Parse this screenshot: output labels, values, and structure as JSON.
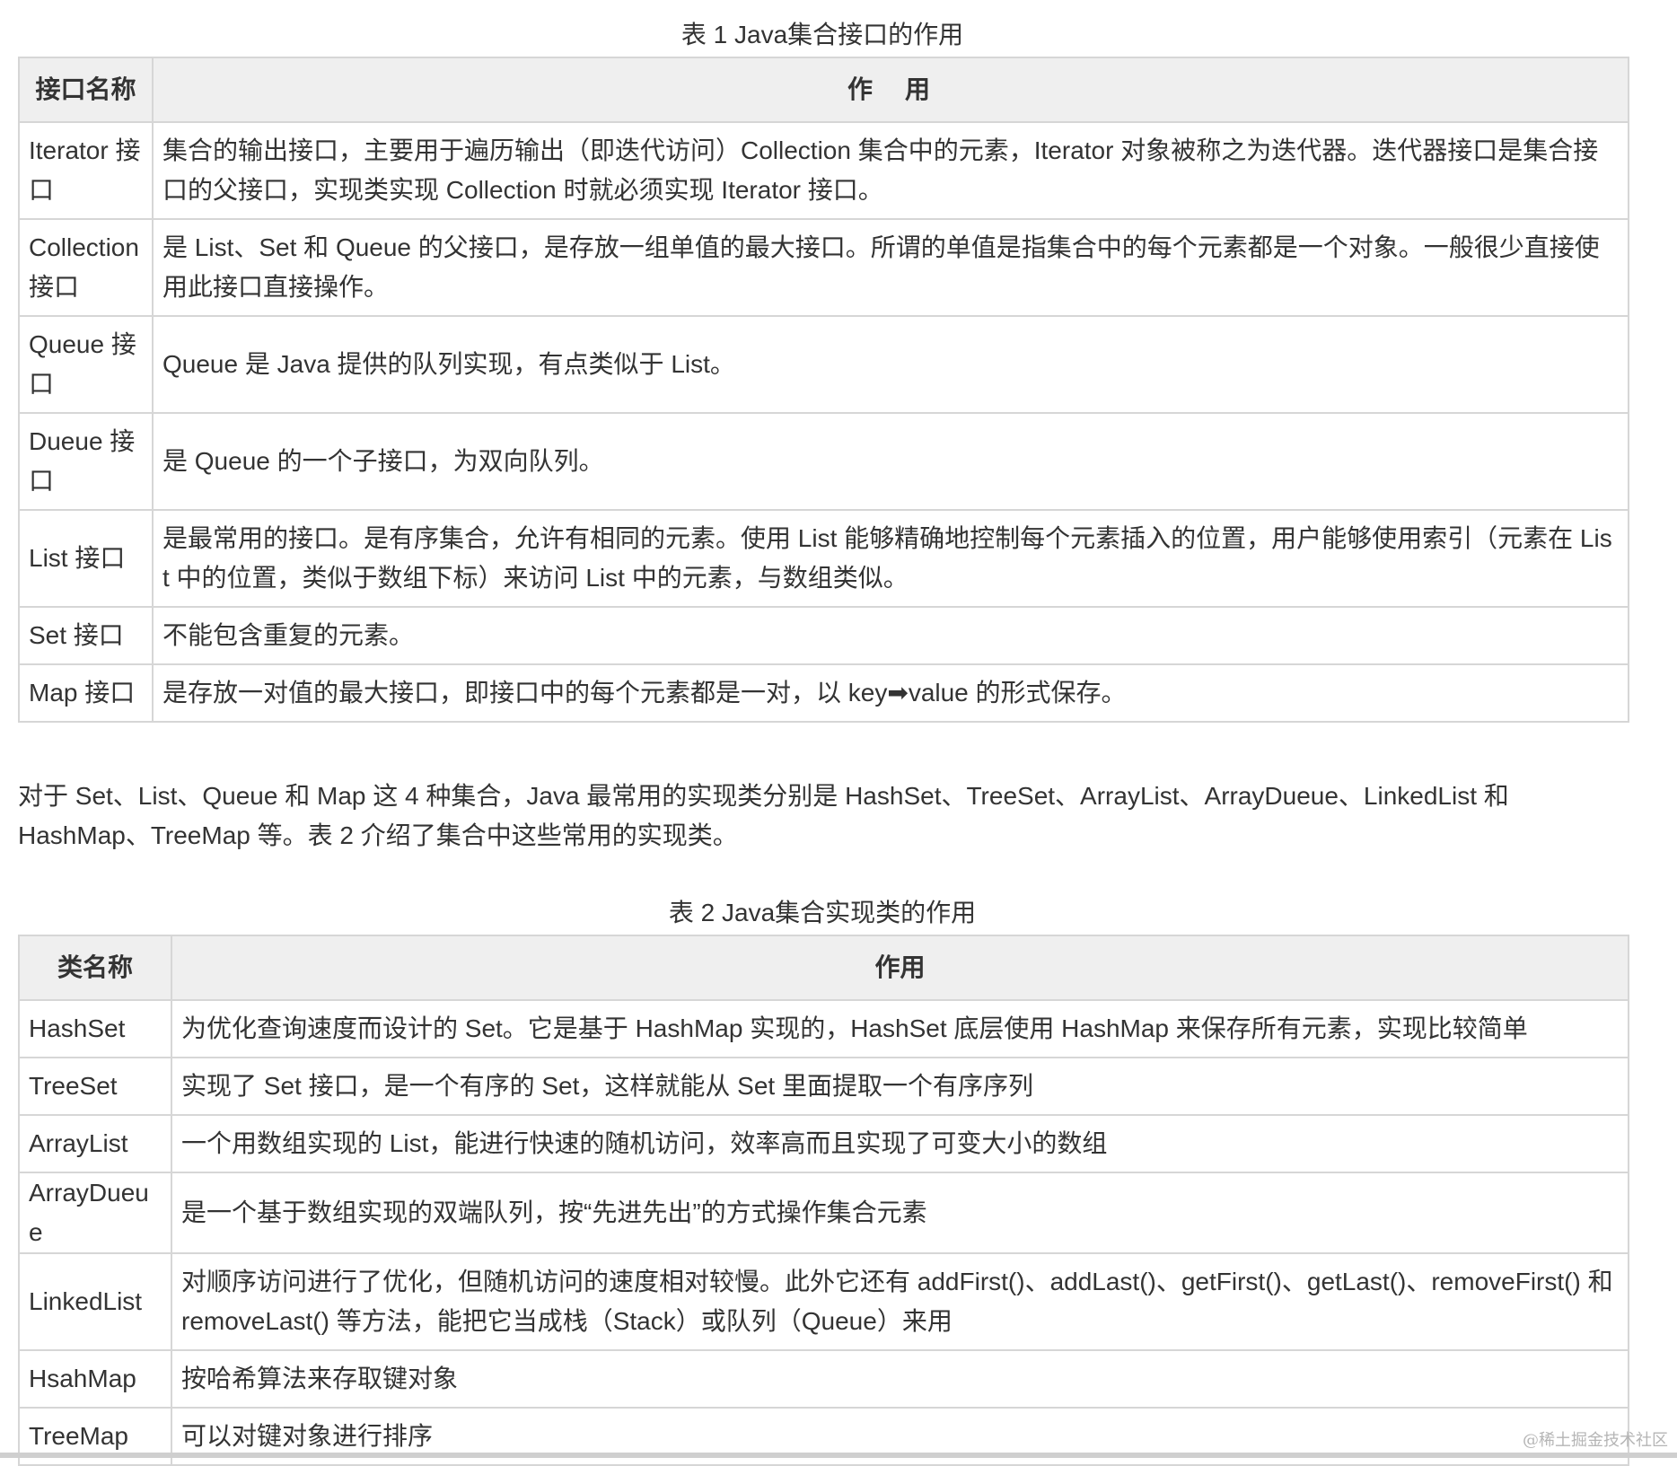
{
  "table1": {
    "caption": "表 1 Java集合接口的作用",
    "headers": [
      "接口名称",
      "作　用"
    ],
    "rows": [
      {
        "name": "Iterator 接口",
        "desc": "集合的输出接口，主要用于遍历输出（即迭代访问）Collection 集合中的元素，Iterator 对象被称之为迭代器。迭代器接口是集合接口的父接口，实现类实现 Collection 时就必须实现 Iterator 接口。"
      },
      {
        "name": "Collection 接口",
        "desc": "是 List、Set 和 Queue 的父接口，是存放一组单值的最大接口。所谓的单值是指集合中的每个元素都是一个对象。一般很少直接使用此接口直接操作。"
      },
      {
        "name": "Queue 接口",
        "desc": "Queue 是 Java 提供的队列实现，有点类似于 List。"
      },
      {
        "name": "Dueue 接口",
        "desc": "是 Queue 的一个子接口，为双向队列。"
      },
      {
        "name": "List 接口",
        "desc": "是最常用的接口。是有序集合，允许有相同的元素。使用 List 能够精确地控制每个元素插入的位置，用户能够使用索引（元素在 List 中的位置，类似于数组下标）来访问 List 中的元素，与数组类似。"
      },
      {
        "name": "Set 接口",
        "desc": "不能包含重复的元素。"
      },
      {
        "name": "Map 接口",
        "desc": "是存放一对值的最大接口，即接口中的每个元素都是一对，以 key➡value 的形式保存。"
      }
    ]
  },
  "paragraph": "对于 Set、List、Queue 和 Map 这 4 种集合，Java 最常用的实现类分别是 HashSet、TreeSet、ArrayList、ArrayDueue、LinkedList 和 HashMap、TreeMap 等。表 2 介绍了集合中这些常用的实现类。",
  "table2": {
    "caption": "表 2 Java集合实现类的作用",
    "headers": [
      "类名称",
      "作用"
    ],
    "rows": [
      {
        "name": "HashSet",
        "desc": "为优化查询速度而设计的 Set。它是基于 HashMap 实现的，HashSet 底层使用 HashMap 来保存所有元素，实现比较简单"
      },
      {
        "name": "TreeSet",
        "desc": "实现了 Set 接口，是一个有序的 Set，这样就能从 Set 里面提取一个有序序列"
      },
      {
        "name": "ArrayList",
        "desc": "一个用数组实现的 List，能进行快速的随机访问，效率高而且实现了可变大小的数组"
      },
      {
        "name": "ArrayDueue",
        "desc": "是一个基于数组实现的双端队列，按“先进先出”的方式操作集合元素"
      },
      {
        "name": "LinkedList",
        "desc": "对顺序访问进行了优化，但随机访问的速度相对较慢。此外它还有 addFirst()、addLast()、getFirst()、getLast()、removeFirst() 和 removeLast() 等方法，能把它当成栈（Stack）或队列（Queue）来用"
      },
      {
        "name": "HsahMap",
        "desc": "按哈希算法来存取键对象"
      },
      {
        "name": "TreeMap",
        "desc": "可以对键对象进行排序"
      }
    ]
  },
  "watermark": "@稀土掘金技术社区"
}
